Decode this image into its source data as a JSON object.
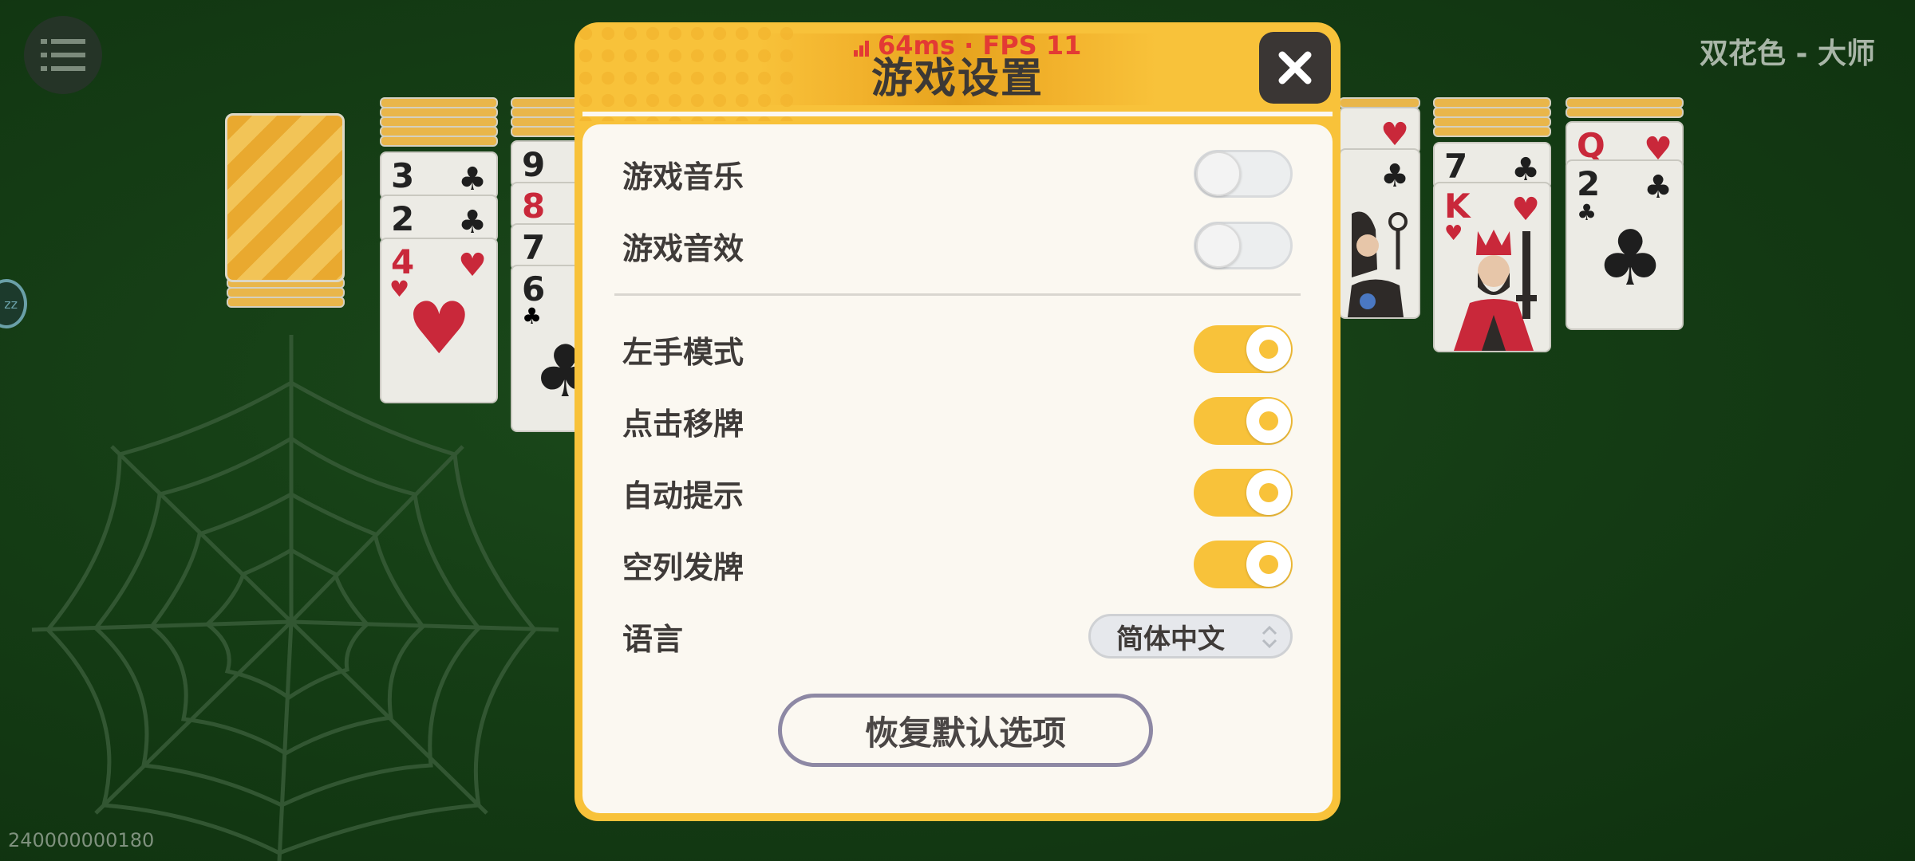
{
  "top": {
    "mode_label": "双花色 - 大师",
    "device_id": "240000000180",
    "side_tab_text": "zz"
  },
  "cards": {
    "left_pile_1": [
      {
        "rank": "3",
        "suit": "♣",
        "color": "black"
      },
      {
        "rank": "2",
        "suit": "♣",
        "color": "black"
      },
      {
        "rank": "4",
        "suit": "♥",
        "color": "red"
      }
    ],
    "left_pile_2": [
      {
        "rank": "9",
        "suit": "",
        "color": "black"
      },
      {
        "rank": "8",
        "suit": "",
        "color": "red"
      },
      {
        "rank": "7",
        "suit": "",
        "color": "black"
      },
      {
        "rank": "6",
        "suit": "♣",
        "color": "black"
      }
    ],
    "right_pile_2": [
      {
        "rank": "7",
        "suit": "♣",
        "color": "black"
      },
      {
        "rank": "K",
        "suit": "♥",
        "color": "red"
      }
    ],
    "right_pile_3": [
      {
        "rank": "Q",
        "suit": "♥",
        "color": "red"
      },
      {
        "rank": "2",
        "suit": "♣",
        "color": "black"
      }
    ]
  },
  "dialog": {
    "title": "游戏设置",
    "fps_text": "64ms · FPS 11",
    "settings": [
      {
        "label": "游戏音乐",
        "on": false
      },
      {
        "label": "游戏音效",
        "on": false
      },
      {
        "label": "左手模式",
        "on": true
      },
      {
        "label": "点击移牌",
        "on": true
      },
      {
        "label": "自动提示",
        "on": true
      },
      {
        "label": "空列发牌",
        "on": true
      }
    ],
    "language_label": "语言",
    "language_value": "简体中文",
    "reset_label": "恢复默认选项"
  },
  "colors": {
    "accent": "#f8c23a",
    "background": "#153d15",
    "panel": "#fbf8f1",
    "fps": "#e33a34"
  },
  "icons": [
    "menu-icon",
    "close-icon",
    "signal-bars-icon",
    "updown-arrows-icon",
    "spider-web-icon"
  ]
}
